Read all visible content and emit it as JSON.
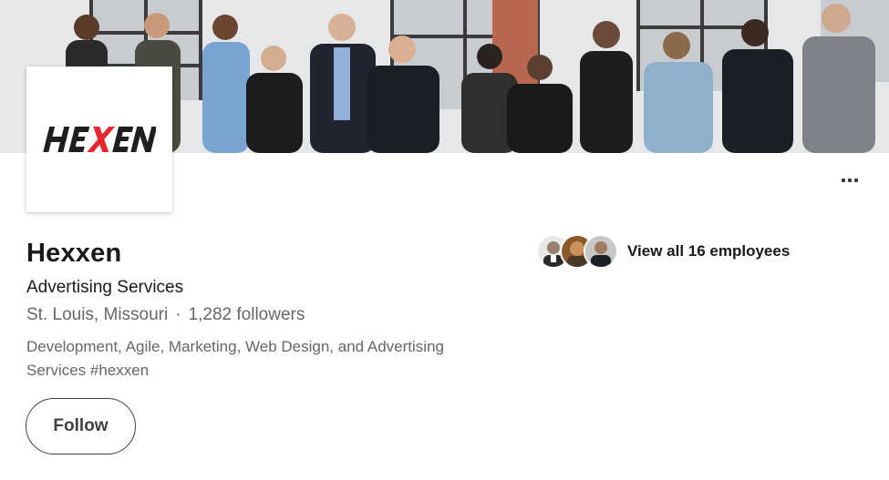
{
  "company": {
    "name": "Hexxen",
    "industry": "Advertising Services",
    "location": "St. Louis, Missouri",
    "separator": "·",
    "followers": "1,282 followers",
    "tagline": "Development, Agile, Marketing, Web Design, and Advertising Services #hexxen",
    "logo_text": "HEXEN"
  },
  "actions": {
    "follow_label": "Follow",
    "more_icon": "ellipsis-icon"
  },
  "employees": {
    "label": "View all 16 employees",
    "avatar_count": 3
  },
  "colors": {
    "logo_dark": "#1f1f1f",
    "logo_accent": "#e8262f",
    "text_primary": "#191919",
    "text_secondary": "#666666"
  }
}
